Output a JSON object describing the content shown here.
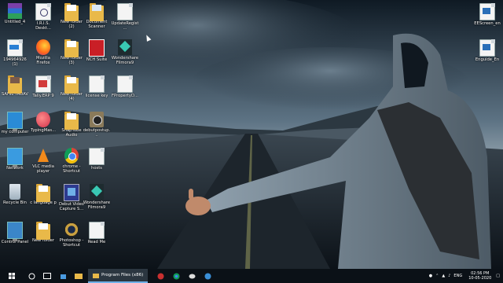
{
  "desktop": {
    "icons": [
      {
        "label": "Untitled_4",
        "icon": "winrar-icon"
      },
      {
        "label": "I.R.I.S. Deskt...",
        "icon": "iris-icon"
      },
      {
        "label": "New folder (2)",
        "icon": "folder-icon"
      },
      {
        "label": "Document Scanner",
        "icon": "folder-doc-icon"
      },
      {
        "label": "UpdateRegist...",
        "icon": "file-icon"
      },
      {
        "label": "194964926 (1)",
        "icon": "pdf-icon"
      },
      {
        "label": "Mozilla Firefox",
        "icon": "firefox-icon"
      },
      {
        "label": "New folder (3)",
        "icon": "folder-icon"
      },
      {
        "label": "NCH Suite",
        "icon": "nch-icon"
      },
      {
        "label": "Wondershare Filmora9",
        "icon": "filmora-icon"
      },
      {
        "label": "SAHIL YADAV",
        "icon": "folder-photo-icon"
      },
      {
        "label": "Tally.ERP 9",
        "icon": "tally-icon"
      },
      {
        "label": "New folder (4)",
        "icon": "folder-icon"
      },
      {
        "label": "license key",
        "icon": "file-icon"
      },
      {
        "label": "FPropertyD...",
        "icon": "file-icon"
      },
      {
        "label": "my computer",
        "icon": "computer-icon"
      },
      {
        "label": "TypingMas...",
        "icon": "typingmaster-icon"
      },
      {
        "label": "SnapTube Audio",
        "icon": "folder-icon"
      },
      {
        "label": "debutpostup...",
        "icon": "debut-icon"
      },
      {
        "label": "Network",
        "icon": "network-icon"
      },
      {
        "label": "VLC media player",
        "icon": "vlc-icon"
      },
      {
        "label": "chrome - Shortcut",
        "icon": "chrome-icon"
      },
      {
        "label": "hosts",
        "icon": "file-icon"
      },
      {
        "label": "Recycle Bin",
        "icon": "recycle-bin-icon"
      },
      {
        "label": "c language p",
        "icon": "folder-icon"
      },
      {
        "label": "Debut Video Capture S...",
        "icon": "debut-icon"
      },
      {
        "label": "Wondershare Filmora9",
        "icon": "filmora-icon"
      },
      {
        "label": "Control Panel",
        "icon": "control-panel-icon"
      },
      {
        "label": "New folder",
        "icon": "folder-icon"
      },
      {
        "label": "Photoshop - Shortcut",
        "icon": "photoshop-icon"
      },
      {
        "label": "Read Me",
        "icon": "file-icon"
      }
    ],
    "right_icons": [
      {
        "label": "EEScreen_en",
        "icon": "eescreen-icon"
      },
      {
        "label": "Enguide_En",
        "icon": "enguide-icon"
      }
    ]
  },
  "taskbar": {
    "task_label": "Program Files (x86)",
    "language": "ENG",
    "time": "02:56 PM",
    "date": "10-05-2020"
  },
  "colors": {
    "taskbar": "#0b1117",
    "accent": "#6fb0e8"
  }
}
